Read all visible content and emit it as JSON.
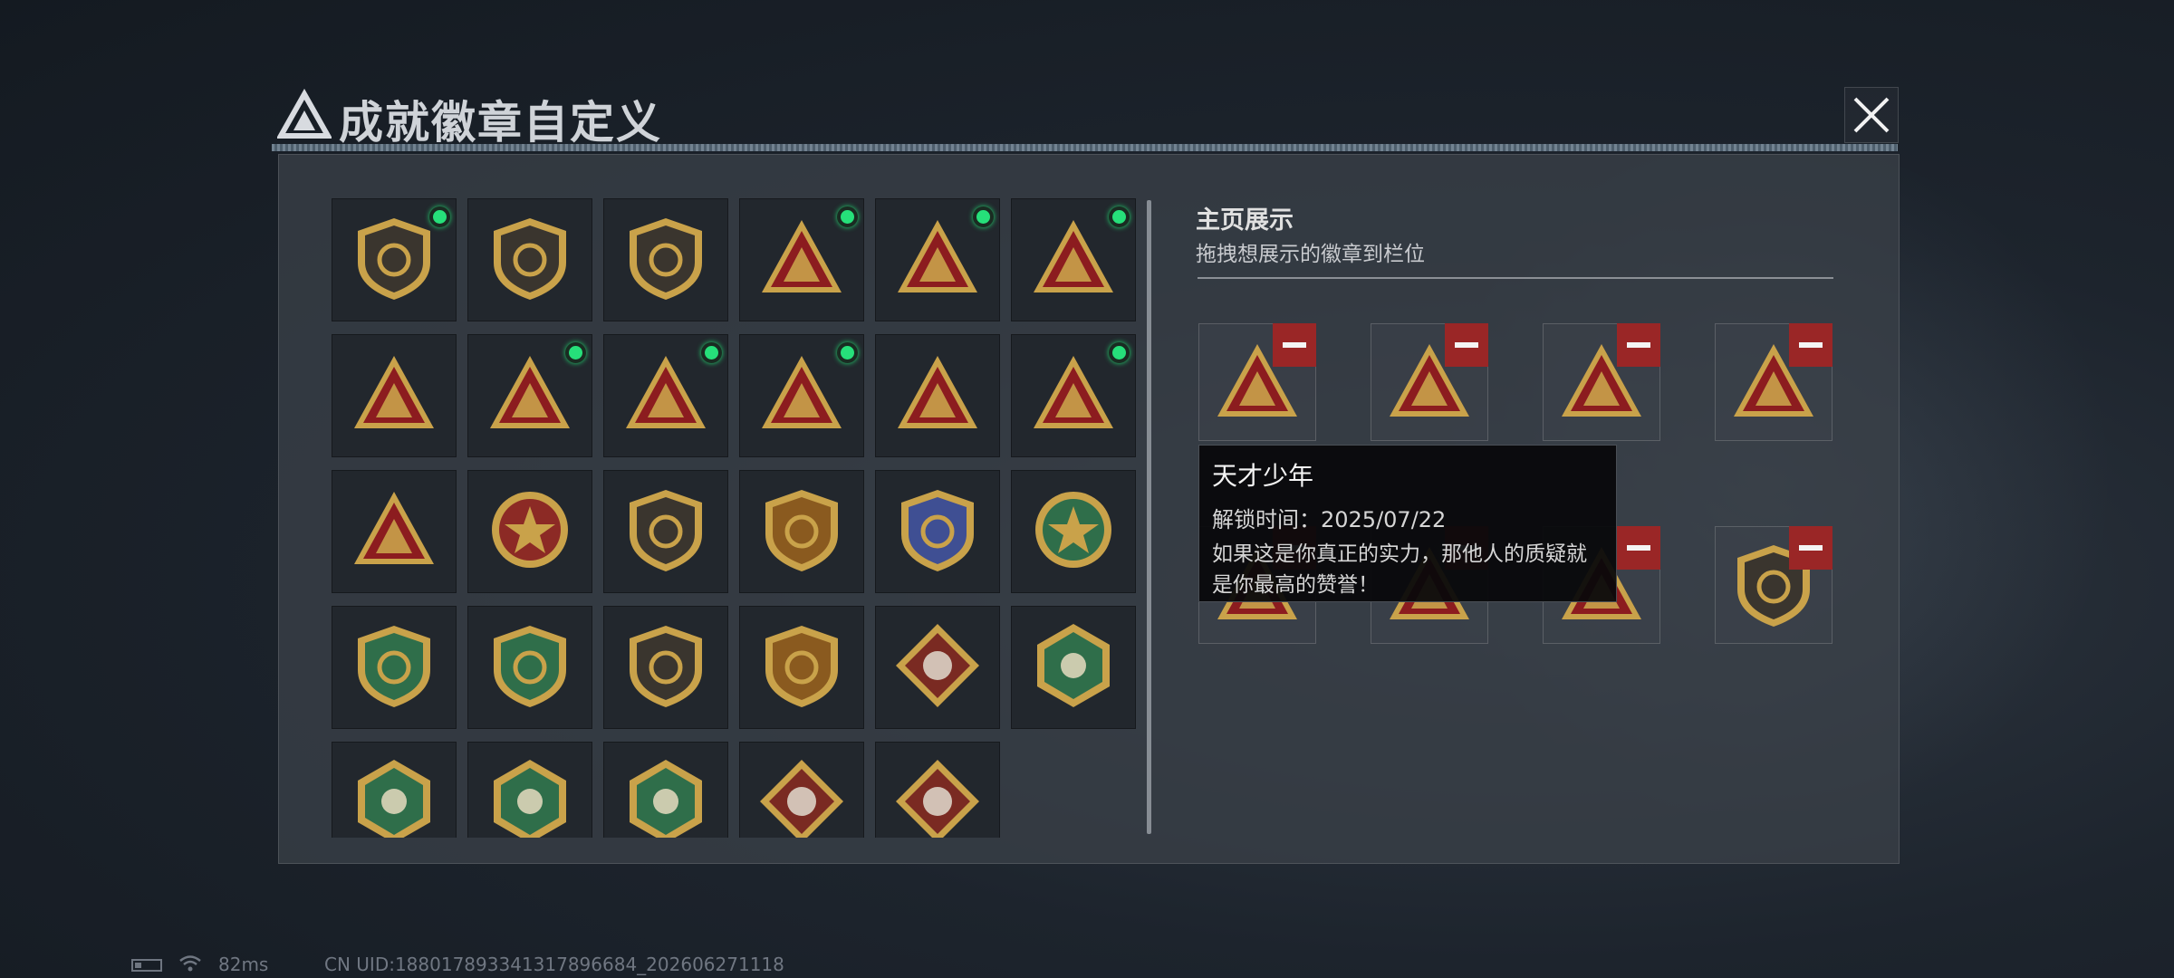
{
  "header": {
    "title": "成就徽章自定义"
  },
  "colors": {
    "accent_green": "#26e07a",
    "remove_red": "#9a2626",
    "badge_gold": "#c9a24a",
    "badge_red": "#8c1c1f",
    "badge_green": "#2f6e4a"
  },
  "badge_grid": [
    {
      "icon": "shield-triangle-badge-icon",
      "shape": "shield",
      "owned": true
    },
    {
      "icon": "helicopter-badge-icon",
      "shape": "shield",
      "owned": false
    },
    {
      "icon": "dagger-badge-icon",
      "shape": "shield",
      "owned": false
    },
    {
      "icon": "ration-can-badge-icon",
      "shape": "triangle",
      "owned": true
    },
    {
      "icon": "rock-hand-badge-icon",
      "shape": "triangle",
      "owned": true
    },
    {
      "icon": "egg-nest-badge-icon",
      "shape": "triangle",
      "owned": true
    },
    {
      "icon": "number-one-badge-icon",
      "shape": "triangle",
      "owned": false
    },
    {
      "icon": "usb-drive-badge-icon",
      "shape": "triangle",
      "owned": true
    },
    {
      "icon": "swimmer-badge-icon",
      "shape": "triangle",
      "owned": true
    },
    {
      "icon": "dice-hands-badge-icon",
      "shape": "triangle",
      "owned": true
    },
    {
      "icon": "elephant-badge-icon",
      "shape": "triangle",
      "owned": false
    },
    {
      "icon": "rocket-badge-icon",
      "shape": "triangle",
      "owned": true
    },
    {
      "icon": "cannon-badge-icon",
      "shape": "triangle",
      "owned": false
    },
    {
      "icon": "star-compass-badge-icon",
      "shape": "circle",
      "owned": false
    },
    {
      "icon": "crest-shield-badge-icon",
      "shape": "shield",
      "owned": false
    },
    {
      "icon": "gold-eagle-shield-badge-icon",
      "shape": "shield",
      "owned": false
    },
    {
      "icon": "blue-gem-shield-badge-icon",
      "shape": "shield",
      "owned": false
    },
    {
      "icon": "green-flower-badge-icon",
      "shape": "circle",
      "owned": false
    },
    {
      "icon": "green-rifle-crosshair-badge-icon",
      "shape": "shield",
      "owned": false
    },
    {
      "icon": "green-sniper-crosshair-badge-icon",
      "shape": "shield",
      "owned": false
    },
    {
      "icon": "brown-rifle-crosshair-badge-icon",
      "shape": "shield",
      "owned": false
    },
    {
      "icon": "gold-blade-crest-badge-icon",
      "shape": "shield",
      "owned": false
    },
    {
      "icon": "wolf-diamond-badge-icon",
      "shape": "diamond",
      "owned": false
    },
    {
      "icon": "wasp-hexagon-badge-icon",
      "shape": "hexagon",
      "owned": false
    },
    {
      "icon": "hornet-hexagon-badge-icon",
      "shape": "hexagon",
      "owned": false
    },
    {
      "icon": "medic-hexagon-badge-icon",
      "shape": "hexagon",
      "owned": false
    },
    {
      "icon": "backpack-hexagon-badge-icon",
      "shape": "hexagon",
      "owned": false
    },
    {
      "icon": "dragon-diamond-badge-icon",
      "shape": "diamond",
      "owned": false
    },
    {
      "icon": "runner-diamond-badge-icon",
      "shape": "diamond",
      "owned": false
    }
  ],
  "display": {
    "title": "主页展示",
    "subtitle": "拖拽想展示的徽章到栏位",
    "slots": [
      {
        "icon": "usb-drive-badge-icon",
        "shape": "triangle"
      },
      {
        "icon": "swimmer-badge-icon",
        "shape": "triangle"
      },
      {
        "icon": "dice-hands-badge-icon",
        "shape": "triangle"
      },
      {
        "icon": "ration-can-badge-icon",
        "shape": "triangle"
      },
      {
        "icon": "egg-nest-badge-icon",
        "shape": "triangle"
      },
      {
        "icon": "rock-hand-badge-icon",
        "shape": "triangle"
      },
      {
        "icon": "rocket-badge-icon",
        "shape": "triangle"
      },
      {
        "icon": "shield-triangle-badge-icon",
        "shape": "shield"
      }
    ]
  },
  "tooltip": {
    "title": "天才少年",
    "unlock_time": "解锁时间：2025/07/22",
    "description": "如果这是你真正的实力，那他人的质疑就是你最高的赞誉！"
  },
  "status_bar": {
    "ping": "82ms",
    "uid": "CN UID:18801789334131789668‌4_202606271118"
  }
}
